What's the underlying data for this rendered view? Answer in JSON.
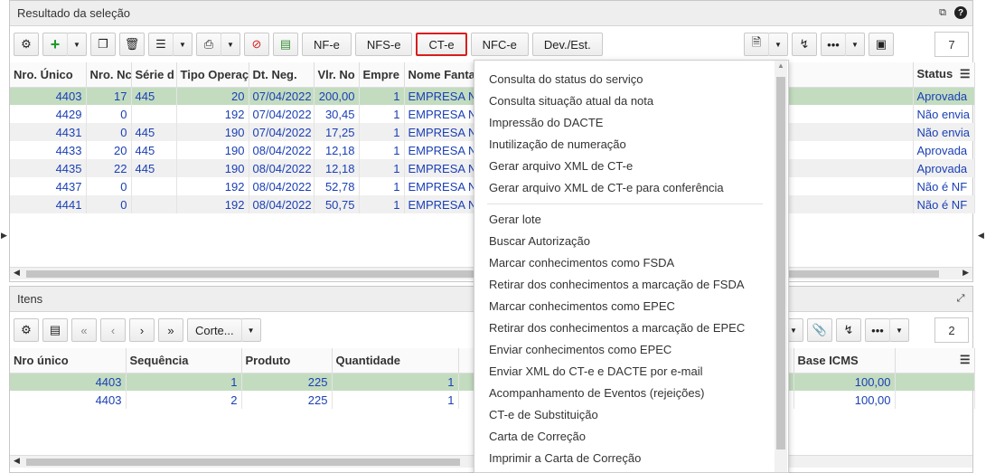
{
  "top_panel": {
    "title": "Resultado da seleção",
    "toolbar": {
      "nfe": "NF-e",
      "nfse": "NFS-e",
      "cte": "CT-e",
      "nfce": "NFC-e",
      "dev_est": "Dev./Est.",
      "counter": "7"
    },
    "columns": [
      "Nro. Único",
      "Nro. Nc",
      "Série d",
      "Tipo Operaç",
      "Dt. Neg.",
      "Vlr. No",
      "Empre",
      "Nome Fanta",
      "Status"
    ],
    "rows": [
      {
        "nro_unico": "4403",
        "nro_nota": "17",
        "serie": "445",
        "tipo_oper": "20",
        "dt_neg": "07/04/2022",
        "vlr": "200,00",
        "emp": "1",
        "nome": "EMPRESA N",
        "status": "Aprovada"
      },
      {
        "nro_unico": "4429",
        "nro_nota": "0",
        "serie": "",
        "tipo_oper": "192",
        "dt_neg": "07/04/2022",
        "vlr": "30,45",
        "emp": "1",
        "nome": "EMPRESA N",
        "status": "Não envia"
      },
      {
        "nro_unico": "4431",
        "nro_nota": "0",
        "serie": "445",
        "tipo_oper": "190",
        "dt_neg": "07/04/2022",
        "vlr": "17,25",
        "emp": "1",
        "nome": "EMPRESA N",
        "status": "Não envia"
      },
      {
        "nro_unico": "4433",
        "nro_nota": "20",
        "serie": "445",
        "tipo_oper": "190",
        "dt_neg": "08/04/2022",
        "vlr": "12,18",
        "emp": "1",
        "nome": "EMPRESA N",
        "status": "Aprovada"
      },
      {
        "nro_unico": "4435",
        "nro_nota": "22",
        "serie": "445",
        "tipo_oper": "190",
        "dt_neg": "08/04/2022",
        "vlr": "12,18",
        "emp": "1",
        "nome": "EMPRESA N",
        "status": "Aprovada"
      },
      {
        "nro_unico": "4437",
        "nro_nota": "0",
        "serie": "",
        "tipo_oper": "192",
        "dt_neg": "08/04/2022",
        "vlr": "52,78",
        "emp": "1",
        "nome": "EMPRESA N",
        "status": "Não é NF"
      },
      {
        "nro_unico": "4441",
        "nro_nota": "0",
        "serie": "",
        "tipo_oper": "192",
        "dt_neg": "08/04/2022",
        "vlr": "50,75",
        "emp": "1",
        "nome": "EMPRESA N",
        "status": "Não é NF"
      }
    ]
  },
  "items_panel": {
    "title": "Itens",
    "corte_label": "Corte...",
    "counter": "2",
    "columns": [
      "Nro único",
      "Sequência",
      "Produto",
      "Quantidade",
      "Base ICMS"
    ],
    "rows": [
      {
        "nro_unico": "4403",
        "seq": "1",
        "produto": "225",
        "qtd": "1",
        "base_icms": "100,00"
      },
      {
        "nro_unico": "4403",
        "seq": "2",
        "produto": "225",
        "qtd": "1",
        "base_icms": "100,00"
      }
    ]
  },
  "cte_menu": {
    "group1": [
      "Consulta do status do serviço",
      "Consulta situação atual da nota",
      "Impressão do DACTE",
      "Inutilização de numeração",
      "Gerar arquivo XML de CT-e",
      "Gerar arquivo XML de CT-e para conferência"
    ],
    "group2": [
      "Gerar lote",
      "Buscar Autorização",
      "Marcar conhecimentos como FSDA",
      "Retirar dos conhecimentos a marcação de FSDA",
      "Marcar conhecimentos como EPEC",
      "Retirar dos conhecimentos a marcação de EPEC",
      "Enviar conhecimentos como EPEC",
      "Enviar XML do CT-e e DACTE por e-mail",
      "Acompanhamento de Eventos (rejeições)",
      "CT-e de Substituição",
      "Carta de Correção",
      "Imprimir a Carta de Correção"
    ]
  },
  "colors": {
    "selected_row": "#c3dcc0",
    "link_blue": "#1a3fb5",
    "active_border": "#d81e1e"
  }
}
